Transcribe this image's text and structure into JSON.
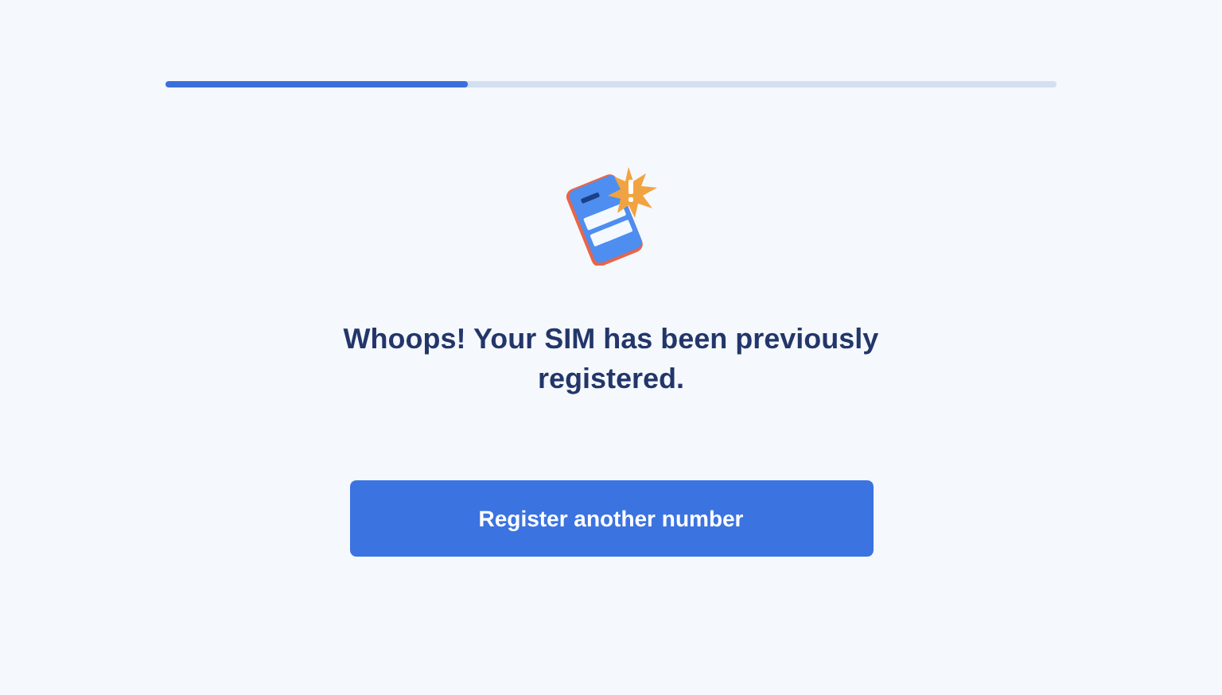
{
  "progress": {
    "level": 0.34
  },
  "message": "Whoops! Your SIM has been previously registered.",
  "button": {
    "label": "Register another number"
  }
}
